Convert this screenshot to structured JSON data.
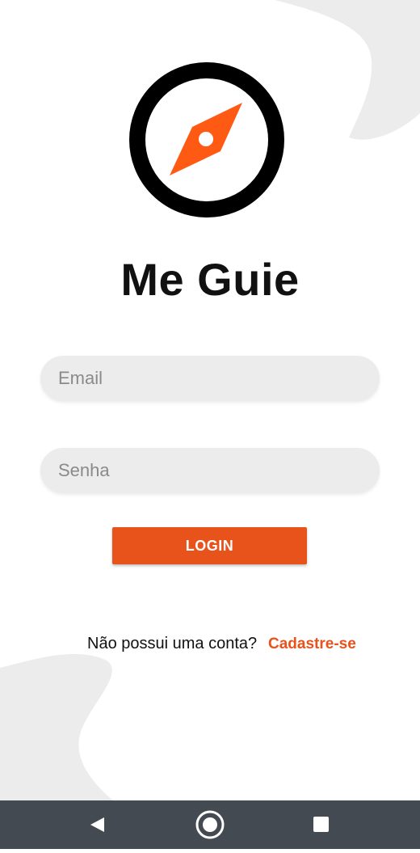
{
  "app": {
    "title": "Me Guie"
  },
  "form": {
    "email_placeholder": "Email",
    "password_placeholder": "Senha",
    "login_label": "LOGIN"
  },
  "signup": {
    "prompt": "Não possui uma conta?",
    "link_label": "Cadastre-se"
  },
  "icons": {
    "logo": "compass-icon",
    "nav_back": "back-triangle-icon",
    "nav_home": "home-circle-icon",
    "nav_recents": "recents-square-icon"
  },
  "colors": {
    "accent": "#e8521b",
    "field_background": "#ececec",
    "background_shape": "#ececec",
    "nav_bar": "#434a52",
    "text": "#111111"
  }
}
